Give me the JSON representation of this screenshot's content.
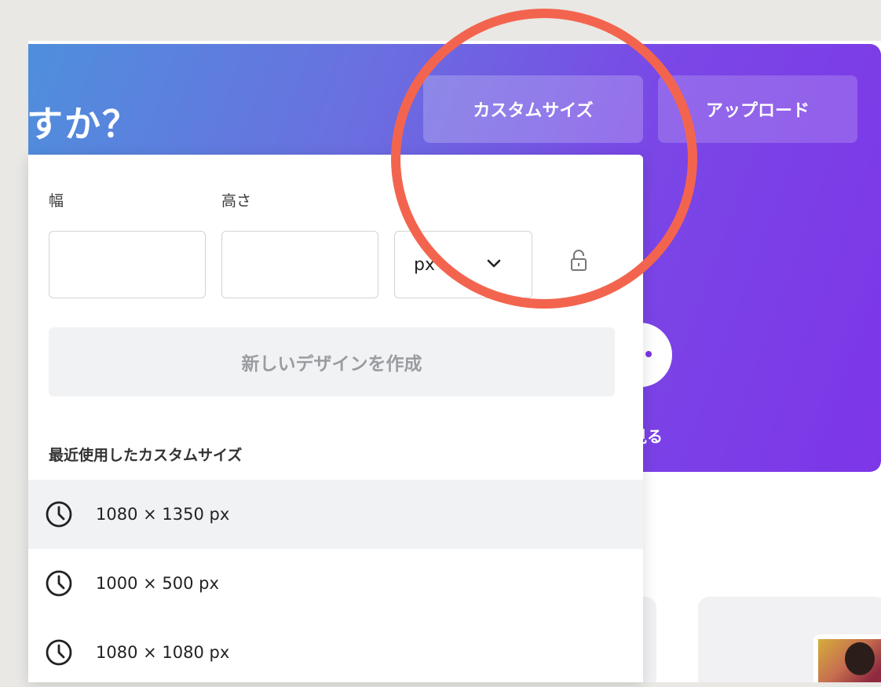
{
  "hero": {
    "title_fragment": "すか？",
    "custom_size_button": "カスタムサイズ",
    "upload_button": "アップロード",
    "see_more": "見る"
  },
  "custom_size_panel": {
    "width_label": "幅",
    "height_label": "高さ",
    "width_value": "",
    "height_value": "",
    "unit": {
      "selected": "px",
      "icon": "chevron-down-icon"
    },
    "lock_icon": "lock-icon",
    "create_button": "新しいデザインを作成",
    "recent_heading": "最近使用したカスタムサイズ",
    "recent_items": [
      {
        "label": "1080 × 1350 px",
        "icon": "clock-icon"
      },
      {
        "label": "1000 × 500 px",
        "icon": "clock-icon"
      },
      {
        "label": "1080 × 1080 px",
        "icon": "clock-icon"
      }
    ]
  },
  "colors": {
    "hero_gradient_start": "#4f8fdc",
    "hero_gradient_end": "#7d35e8",
    "highlight_ring": "#f3644f",
    "panel_button_bg": "#f1f2f4",
    "disabled_text": "#9b9ca1"
  }
}
